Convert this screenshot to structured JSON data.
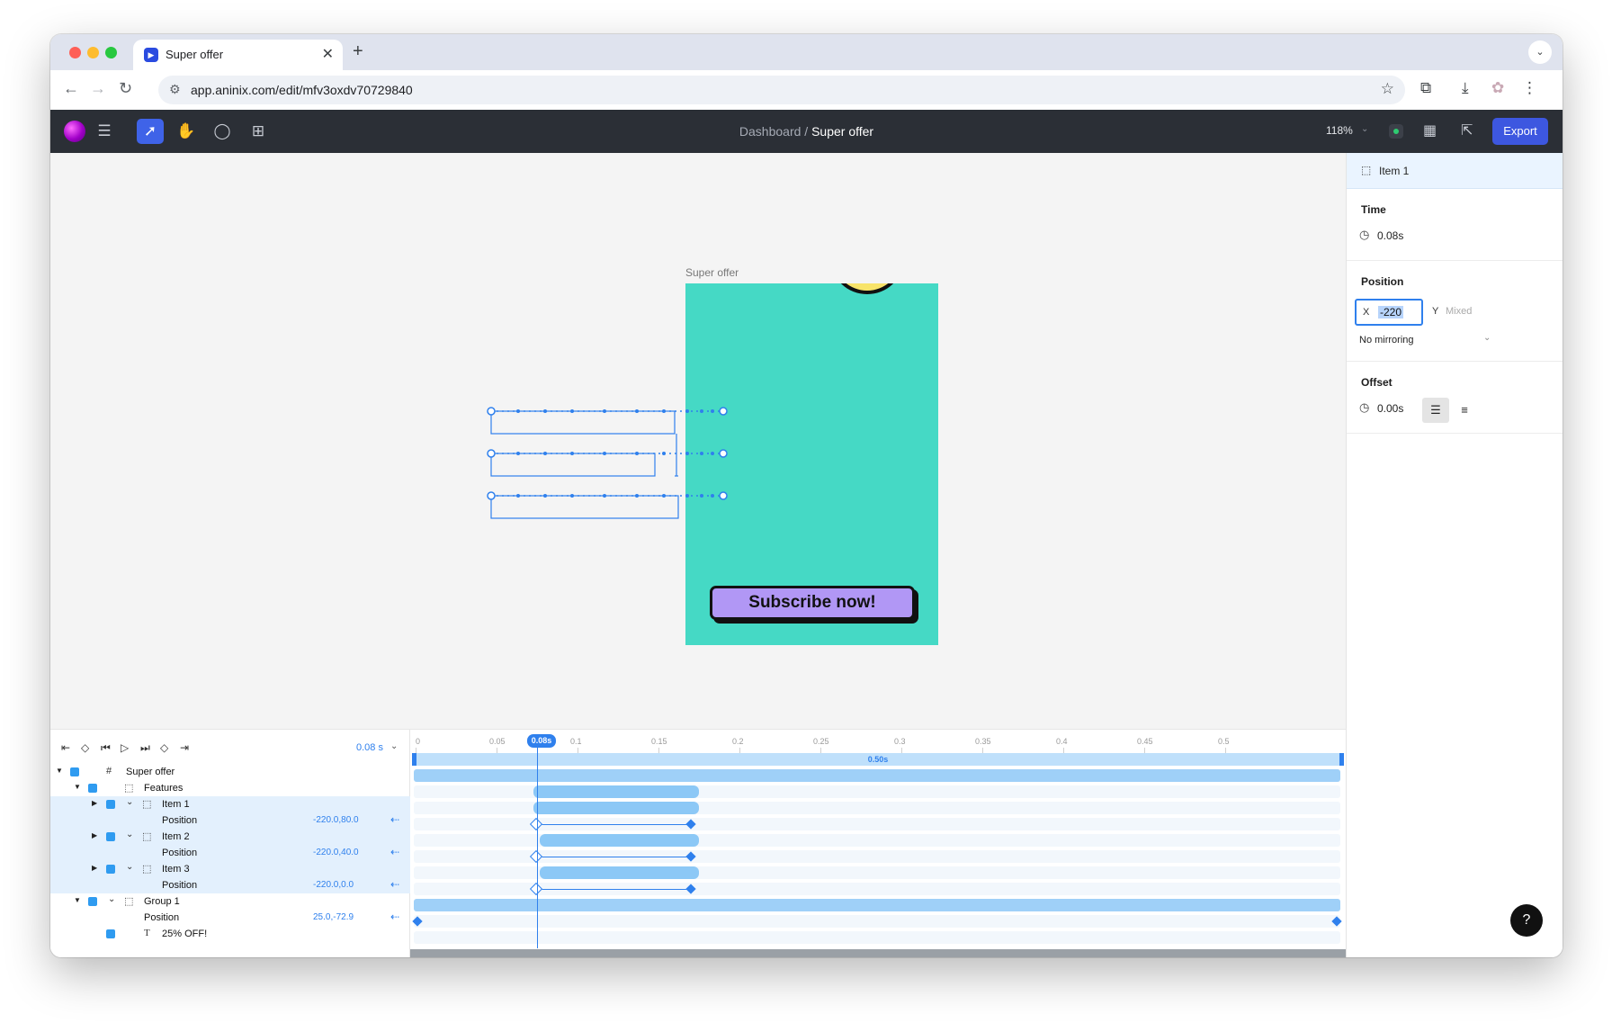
{
  "browser": {
    "tab_title": "Super offer",
    "tab_close": "✕",
    "new_tab": "+",
    "url": "app.aninix.com/edit/mfv3oxdv70729840"
  },
  "app": {
    "breadcrumb_parent": "Dashboard",
    "breadcrumb_sep": " / ",
    "breadcrumb_current": "Super offer",
    "zoom": "118%",
    "export_label": "Export"
  },
  "canvas": {
    "frame_label": "Super offer",
    "subscribe_label": "Subscribe now!"
  },
  "inspector": {
    "header_title": "Item 1",
    "time_title": "Time",
    "time_value": "0.08s",
    "position_title": "Position",
    "x_label": "X",
    "x_value": "-220",
    "y_label": "Y",
    "y_value": "Mixed",
    "mirroring": "No mirroring",
    "offset_title": "Offset",
    "offset_value": "0.00s"
  },
  "timeline": {
    "current_time": "0.08",
    "current_time_unit": "s",
    "playhead_label": "0.08s",
    "duration_label": "0.50s",
    "ticks": [
      "0",
      "0.05",
      "0.1",
      "0.15",
      "0.2",
      "0.25",
      "0.3",
      "0.35",
      "0.4",
      "0.45",
      "0.5"
    ],
    "layers": [
      {
        "name": "Super offer",
        "icon": "#"
      },
      {
        "name": "Features"
      },
      {
        "name": "Item 1"
      },
      {
        "name": "Position",
        "value": "-220.0,80.0"
      },
      {
        "name": "Item 2"
      },
      {
        "name": "Position",
        "value": "-220.0,40.0"
      },
      {
        "name": "Item 3"
      },
      {
        "name": "Position",
        "value": "-220.0,0.0"
      },
      {
        "name": "Group 1"
      },
      {
        "name": "Position",
        "value": "25.0,-72.9"
      },
      {
        "name": "25% OFF!",
        "icon": "T"
      }
    ]
  },
  "colors": {
    "frame_bg": "#45d9c5",
    "button_bg": "#b197f5",
    "accent": "#2f80ed",
    "export_bg": "#3d57e0"
  }
}
